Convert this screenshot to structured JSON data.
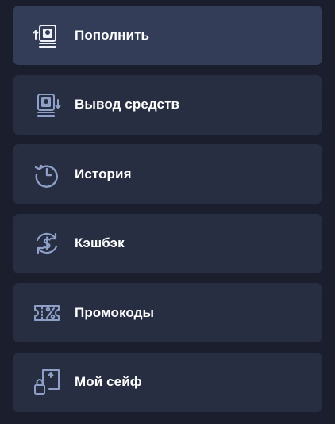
{
  "menu": {
    "items": [
      {
        "label": "Пополнить",
        "icon": "deposit-icon",
        "active": true
      },
      {
        "label": "Вывод средств",
        "icon": "withdraw-icon",
        "active": false
      },
      {
        "label": "История",
        "icon": "history-icon",
        "active": false
      },
      {
        "label": "Кэшбэк",
        "icon": "cashback-icon",
        "active": false
      },
      {
        "label": "Промокоды",
        "icon": "promo-code-icon",
        "active": false
      },
      {
        "label": "Мой сейф",
        "icon": "safe-icon",
        "active": false
      }
    ]
  },
  "colors": {
    "background": "#1b1f2d",
    "item": "#272e42",
    "item_active": "#333d58",
    "icon_light": "#eef1f8",
    "icon_muted": "#8ea0c8",
    "text": "#ffffff"
  }
}
